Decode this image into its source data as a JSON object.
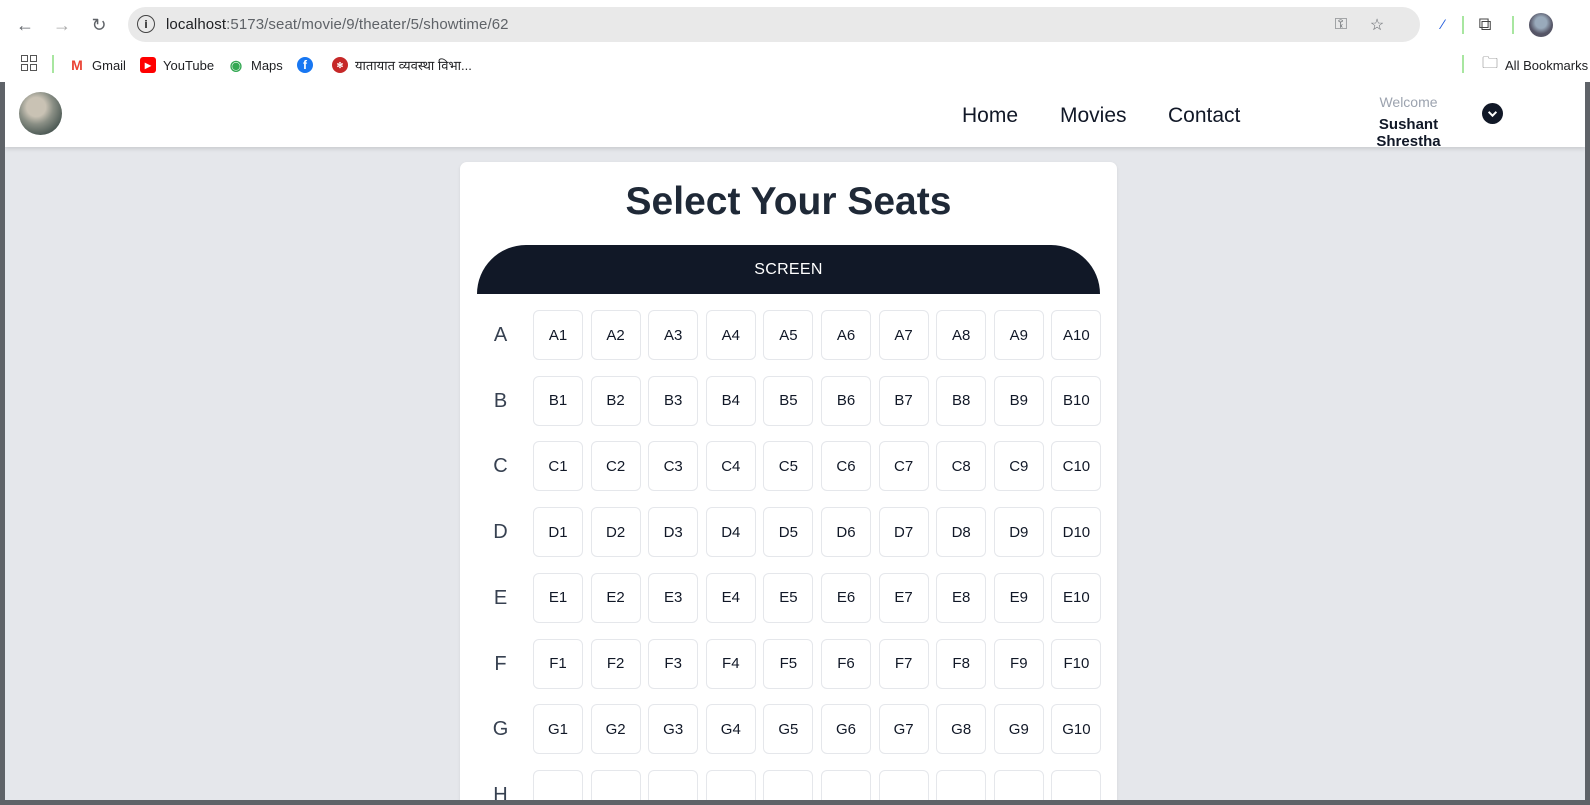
{
  "browser": {
    "url_host": "localhost",
    "url_path": ":5173/seat/movie/9/theater/5/showtime/62",
    "bookmarks": [
      {
        "label": "Gmail",
        "icon": "gmail-icon",
        "color": "#ea4335"
      },
      {
        "label": "YouTube",
        "icon": "youtube-icon",
        "color": "#ff0000"
      },
      {
        "label": "Maps",
        "icon": "maps-icon",
        "color": "#34a853"
      },
      {
        "label": "",
        "icon": "facebook-icon",
        "color": "#1877f2"
      },
      {
        "label": "यातायात व्यवस्था विभा...",
        "icon": "nepal-emblem-icon",
        "color": "#c62828"
      }
    ],
    "all_bookmarks_label": "All Bookmarks"
  },
  "navbar": {
    "links": [
      "Home",
      "Movies",
      "Contact"
    ],
    "welcome": "Welcome",
    "username": "Sushant Shrestha"
  },
  "main": {
    "title": "Select Your Seats",
    "screen_label": "SCREEN",
    "rows": [
      {
        "label": "A",
        "seats": [
          "A1",
          "A2",
          "A3",
          "A4",
          "A5",
          "A6",
          "A7",
          "A8",
          "A9",
          "A10"
        ]
      },
      {
        "label": "B",
        "seats": [
          "B1",
          "B2",
          "B3",
          "B4",
          "B5",
          "B6",
          "B7",
          "B8",
          "B9",
          "B10"
        ]
      },
      {
        "label": "C",
        "seats": [
          "C1",
          "C2",
          "C3",
          "C4",
          "C5",
          "C6",
          "C7",
          "C8",
          "C9",
          "C10"
        ]
      },
      {
        "label": "D",
        "seats": [
          "D1",
          "D2",
          "D3",
          "D4",
          "D5",
          "D6",
          "D7",
          "D8",
          "D9",
          "D10"
        ]
      },
      {
        "label": "E",
        "seats": [
          "E1",
          "E2",
          "E3",
          "E4",
          "E5",
          "E6",
          "E7",
          "E8",
          "E9",
          "E10"
        ]
      },
      {
        "label": "F",
        "seats": [
          "F1",
          "F2",
          "F3",
          "F4",
          "F5",
          "F6",
          "F7",
          "F8",
          "F9",
          "F10"
        ]
      },
      {
        "label": "G",
        "seats": [
          "G1",
          "G2",
          "G3",
          "G4",
          "G5",
          "G6",
          "G7",
          "G8",
          "G9",
          "G10"
        ]
      },
      {
        "label": "H",
        "seats": [
          "",
          "",
          "",
          "",
          "",
          "",
          "",
          "",
          "",
          ""
        ]
      }
    ]
  },
  "colors": {
    "dark": "#111827",
    "page_bg": "#e5e7eb",
    "seat_border": "#e5e7eb"
  }
}
